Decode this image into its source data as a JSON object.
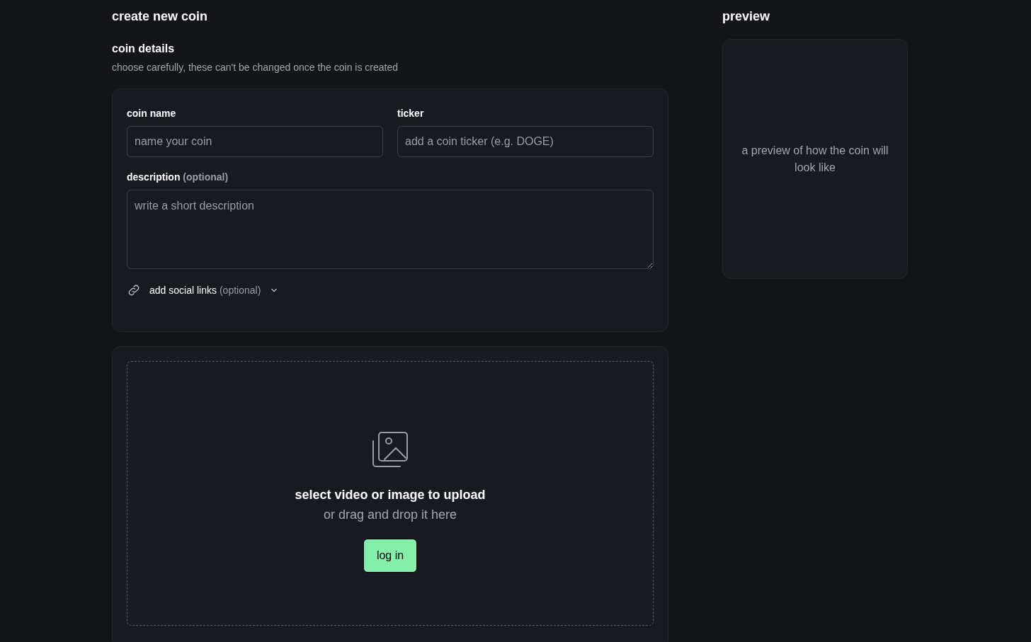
{
  "title": "create new coin",
  "details": {
    "heading": "coin details",
    "subtitle": "choose carefully, these can't be changed once the coin is created"
  },
  "fields": [
    {
      "label": "coin name",
      "placeholder": "name your coin"
    },
    {
      "label": "ticker",
      "placeholder": "add a coin ticker (e.g. DOGE)"
    }
  ],
  "description": {
    "label": "description",
    "hint": "(optional)",
    "placeholder": "write a short description"
  },
  "social_links": {
    "label": "add social links",
    "hint": "(optional)",
    "expanded": false
  },
  "upload": {
    "title": "select video or image to upload",
    "subtitle": "or drag and drop it here",
    "button": "log in"
  },
  "preview": {
    "heading": "preview",
    "text": "a preview of how the coin will look like"
  }
}
